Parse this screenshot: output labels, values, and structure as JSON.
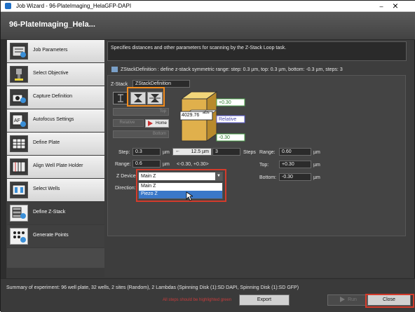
{
  "window": {
    "title": "Job Wizard - 96-PlateImaging_HelaGFP-DAPI",
    "header_title": "96-PlateImaging_Hela..."
  },
  "sidebar": {
    "items": [
      {
        "label": "Job Parameters",
        "icon": "job-parameters-icon"
      },
      {
        "label": "Select Objective",
        "icon": "objective-icon"
      },
      {
        "label": "Capture Definition",
        "icon": "camera-gear-icon"
      },
      {
        "label": "Autofocus Settings",
        "icon": "autofocus-icon"
      },
      {
        "label": "Define Plate",
        "icon": "plate-icon"
      },
      {
        "label": "Align Well Plate Holder",
        "icon": "align-plate-icon"
      },
      {
        "label": "Select Wells",
        "icon": "wells-icon"
      },
      {
        "label": "Define Z-Stack",
        "icon": "zstack-icon"
      },
      {
        "label": "Generate Points",
        "icon": "points-icon"
      }
    ],
    "active_index": 7
  },
  "main": {
    "description": "Specifies distances and other parameters for scanning by the Z-Stack Loop task.",
    "zstack_title": "ZStackDefinition : define z-stack symmetric range: step: 0.3 µm, top: 0.3 µm, bottom: -0.3 µm, steps: 3",
    "zstack_label": "Z-Stack",
    "zstack_name": "ZStackDefinition",
    "top_btn": "Top",
    "relative_btn": "Relative",
    "home_btn": "Home",
    "bottom_btn": "Bottom",
    "cube": {
      "top_value": "+0.30",
      "abs_value": "4029.76",
      "abs_suffix": "abs",
      "relative_label": "Relative",
      "bottom_value": "-0.30"
    },
    "step_label": "Step:",
    "step_value": "0.3",
    "step_unit": "µm",
    "step_range": "12.5 µm",
    "steps_value": "3",
    "steps_label": "Steps",
    "range_label": "Range:",
    "range_value": "0.6",
    "range_unit": "µm",
    "range_bounds": "<-0.30, +0.30>",
    "zdevice_label": "Z Device:",
    "direction_label": "Direction:",
    "right_range_label": "Range:",
    "right_range_value": "0.60",
    "right_range_unit": "µm",
    "top_label": "Top:",
    "top_value": "+0.30",
    "top_unit": "µm",
    "bottom_label": "Bottom:",
    "bottom_value": "-0.30",
    "bottom_unit": "µm",
    "zdevice": {
      "selected": "Main Z",
      "options": [
        "Main Z",
        "Piezo Z"
      ],
      "highlighted": "Piezo Z"
    }
  },
  "footer": {
    "summary": "Summary of experiment: 96 well plate, 32 wells, 2 sites (Random), 2 Lambdas (Spinning Disk (1):SD DAPI, Spinning Disk (1):SD GFP)",
    "warning": "All steps should be highlighted green",
    "export_label": "Export",
    "run_label": "Run",
    "close_label": "Close"
  },
  "colors": {
    "highlight_orange": "#f28c1e",
    "highlight_red": "#d43b2b",
    "selection_blue": "#3a78c9"
  }
}
